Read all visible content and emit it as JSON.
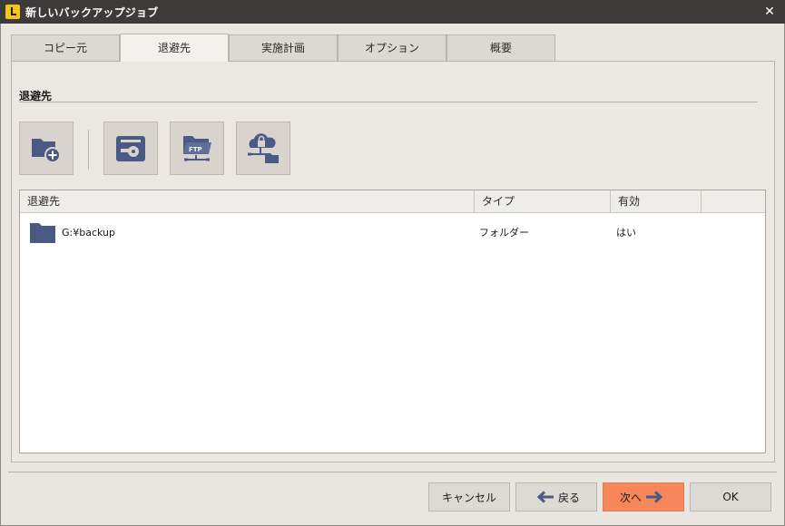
{
  "window": {
    "title": "新しいバックアップジョブ",
    "close_glyph": "✕"
  },
  "tabs": [
    {
      "label": "コピー元",
      "active": false
    },
    {
      "label": "退避先",
      "active": true
    },
    {
      "label": "実施計画",
      "active": false
    },
    {
      "label": "オプション",
      "active": false
    },
    {
      "label": "概要",
      "active": false
    }
  ],
  "section": {
    "title": "退避先"
  },
  "toolbar": {
    "buttons": [
      {
        "name": "add-folder-destination-button",
        "icon": "folder-plus-icon"
      },
      {
        "name": "add-drive-destination-button",
        "icon": "disk-drive-icon"
      },
      {
        "name": "add-ftp-destination-button",
        "icon": "ftp-folder-icon"
      },
      {
        "name": "add-cloud-destination-button",
        "icon": "cloud-lock-icon"
      }
    ]
  },
  "table": {
    "columns": [
      "退避先",
      "タイプ",
      "有効",
      ""
    ],
    "rows": [
      {
        "path": "G:¥backup",
        "type": "フォルダー",
        "enabled": "はい",
        "icon": "folder-icon"
      }
    ]
  },
  "footer": {
    "cancel_label": "キャンセル",
    "back_label": "戻る",
    "next_label": "次へ",
    "ok_label": "OK"
  },
  "colors": {
    "titlebar": "#3d3b39",
    "icon_blue": "#4b5a85",
    "primary_button": "#f5875a"
  }
}
